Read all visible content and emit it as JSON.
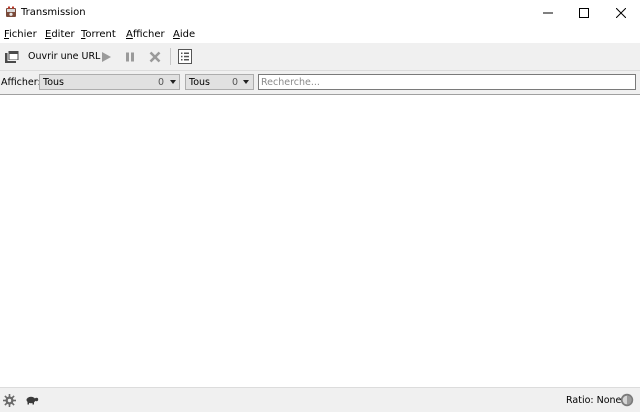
{
  "window": {
    "title": "Transmission"
  },
  "menu": {
    "items": [
      {
        "label": "Fichier",
        "underline": "F",
        "rest": "ichier"
      },
      {
        "label": "Editer",
        "underline": "E",
        "rest": "diter"
      },
      {
        "label": "Torrent",
        "underline": "T",
        "rest": "orrent"
      },
      {
        "label": "Afficher",
        "underline": "A",
        "rest": "fficher"
      },
      {
        "label": "Aide",
        "underline": "A",
        "rest": "ide"
      }
    ]
  },
  "toolbar": {
    "open_url_label": "Ouvrir une URL"
  },
  "filter": {
    "label": "Afficher:",
    "activity": {
      "selected": "Tous",
      "count": "0"
    },
    "tracker": {
      "selected": "Tous",
      "count": "0"
    },
    "search_placeholder": "Recherche...",
    "search_value": ""
  },
  "status": {
    "ratio_text": "Ratio: None"
  },
  "colors": {
    "chrome_bg": "#f0f0f0",
    "list_bg": "#ffffff",
    "combo_bg": "#e1e1e1",
    "disabled_icon": "#9a9a9a"
  }
}
